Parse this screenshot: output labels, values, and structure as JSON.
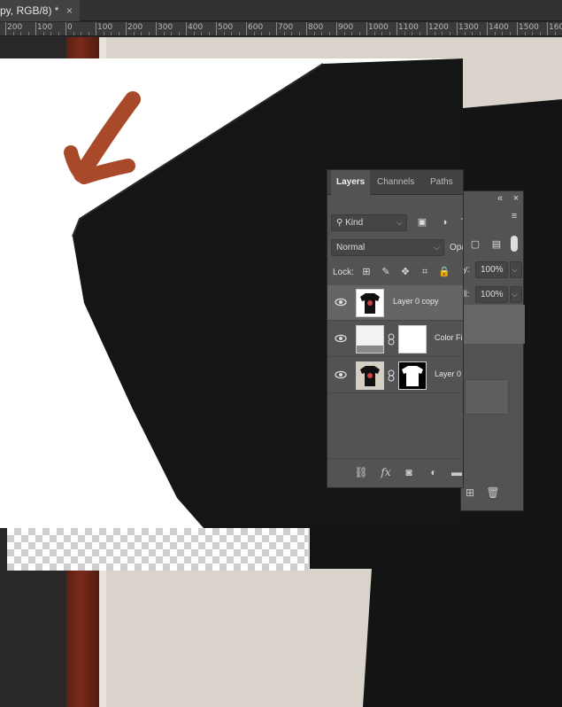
{
  "document_tab": {
    "title": "py, RGB/8) *",
    "close": "×"
  },
  "ruler": {
    "labels": [
      "200",
      "100",
      "0",
      "100",
      "200",
      "300",
      "400",
      "500",
      "600",
      "700",
      "800",
      "900",
      "1000",
      "1100",
      "1200",
      "1300",
      "1400",
      "1500",
      "1600"
    ]
  },
  "layers_panel": {
    "tabs": [
      "Layers",
      "Channels",
      "Paths"
    ],
    "collapse_glyph": "«",
    "close_glyph": "×",
    "filter_kind": "Kind",
    "blend_mode": "Normal",
    "opacity_label": "Opa",
    "opacity_value": "100%",
    "opacity_label_back": "y:",
    "fill_label": "ll:",
    "fill_value": "100%",
    "lock_label": "Lock:",
    "layers": [
      {
        "name": "Layer 0 copy",
        "selected": true,
        "visible": true
      },
      {
        "name": "Color Fi",
        "selected": false,
        "visible": true
      },
      {
        "name": "Layer 0",
        "selected": false,
        "visible": true
      }
    ],
    "bottom_icons": [
      "link-layers-icon",
      "fx-icon",
      "add-mask-icon",
      "adjustment-layer-icon",
      "new-group-icon",
      "new-layer-icon",
      "delete-layer-icon"
    ],
    "fx_label": "fx"
  },
  "colors": {
    "accent_guide": "#39c7c7",
    "arrow": "#a84a2a",
    "shirt": "#151515"
  }
}
